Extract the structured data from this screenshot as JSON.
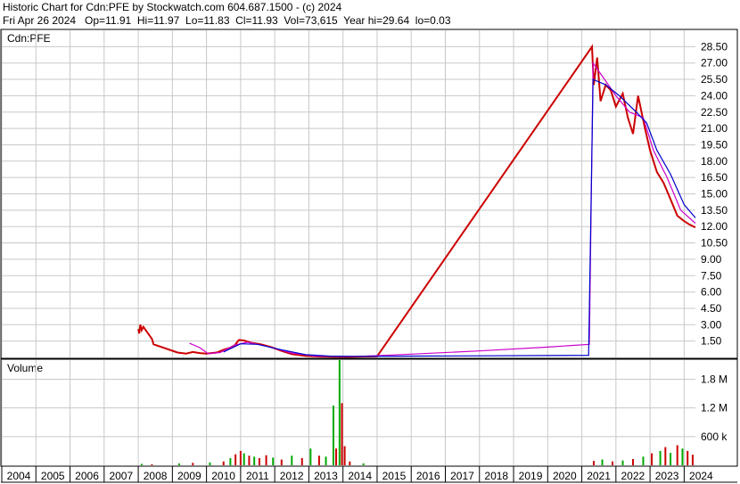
{
  "header": {
    "line1": "Historic Chart for Cdn:PFE by Stockwatch.com 604.687.1500 - (c) 2024",
    "line2": "Fri Apr 26 2024   Op=11.91  Hi=11.97  Lo=11.83  Cl=11.93  Vol=73,615  Year hi=29.64  lo=0.03"
  },
  "chart_data": [
    {
      "type": "line",
      "title": "Cdn:PFE",
      "y_ticks": [
        "28.50",
        "27.00",
        "25.50",
        "24.00",
        "22.50",
        "21.00",
        "19.50",
        "18.00",
        "16.50",
        "15.00",
        "13.50",
        "12.00",
        "10.50",
        "9.00",
        "7.50",
        "6.00",
        "4.50",
        "3.00",
        "1.50"
      ],
      "ylim": [
        0,
        30
      ],
      "x_years": [
        "2004",
        "2005",
        "2006",
        "2007",
        "2008",
        "2009",
        "2010",
        "2011",
        "2012",
        "2013",
        "2014",
        "2015",
        "2016",
        "2017",
        "2018",
        "2019",
        "2020",
        "2021",
        "2022",
        "2023",
        "2024"
      ],
      "xlim": [
        2004,
        2024.33
      ],
      "grid": true,
      "series": [
        {
          "color": "#cc0000",
          "points": [
            [
              2008.0,
              2.6
            ],
            [
              2008.03,
              2.2
            ],
            [
              2008.06,
              3.0
            ],
            [
              2008.1,
              2.5
            ],
            [
              2008.15,
              2.8
            ],
            [
              2008.4,
              1.7
            ],
            [
              2008.45,
              1.2
            ],
            [
              2009.15,
              0.45
            ],
            [
              2009.4,
              0.35
            ],
            [
              2009.6,
              0.5
            ],
            [
              2009.8,
              0.4
            ],
            [
              2010.0,
              0.35
            ],
            [
              2010.3,
              0.45
            ],
            [
              2010.5,
              0.7
            ],
            [
              2010.8,
              1.0
            ],
            [
              2010.95,
              1.6
            ],
            [
              2011.1,
              1.55
            ],
            [
              2011.3,
              1.35
            ],
            [
              2011.6,
              1.2
            ],
            [
              2011.9,
              0.95
            ],
            [
              2012.2,
              0.6
            ],
            [
              2012.5,
              0.3
            ],
            [
              2012.9,
              0.15
            ],
            [
              2013.3,
              0.08
            ],
            [
              2013.7,
              0.06
            ],
            [
              2014.2,
              0.05
            ],
            [
              2014.6,
              0.08
            ],
            [
              2015.0,
              0.1
            ],
            [
              2021.3,
              28.5
            ],
            [
              2021.35,
              25.0
            ],
            [
              2021.45,
              27.5
            ],
            [
              2021.55,
              23.5
            ],
            [
              2021.7,
              25.0
            ],
            [
              2021.85,
              24.5
            ],
            [
              2022.0,
              23.0
            ],
            [
              2022.2,
              24.2
            ],
            [
              2022.35,
              22.0
            ],
            [
              2022.5,
              20.5
            ],
            [
              2022.65,
              24.0
            ],
            [
              2022.85,
              21.0
            ],
            [
              2023.0,
              19.0
            ],
            [
              2023.2,
              17.0
            ],
            [
              2023.4,
              16.0
            ],
            [
              2023.6,
              14.5
            ],
            [
              2023.8,
              13.0
            ],
            [
              2024.0,
              12.5
            ],
            [
              2024.15,
              12.2
            ],
            [
              2024.33,
              11.93
            ]
          ]
        },
        {
          "color": "#cc00cc",
          "points": [
            [
              2009.5,
              1.3
            ],
            [
              2009.8,
              0.9
            ],
            [
              2010.05,
              0.35
            ],
            [
              2010.4,
              0.45
            ],
            [
              2010.8,
              1.1
            ],
            [
              2011.2,
              1.4
            ],
            [
              2011.8,
              1.0
            ],
            [
              2012.5,
              0.4
            ],
            [
              2013.2,
              0.12
            ],
            [
              2014.0,
              0.08
            ],
            [
              2014.5,
              0.1
            ],
            [
              2016.0,
              0.3
            ],
            [
              2018.0,
              0.6
            ],
            [
              2020.0,
              0.95
            ],
            [
              2021.22,
              1.2
            ],
            [
              2021.33,
              27.0
            ],
            [
              2021.6,
              25.8
            ],
            [
              2022.0,
              24.0
            ],
            [
              2022.4,
              22.5
            ],
            [
              2022.8,
              22.0
            ],
            [
              2023.1,
              19.0
            ],
            [
              2023.5,
              16.5
            ],
            [
              2023.9,
              13.5
            ],
            [
              2024.33,
              12.3
            ]
          ]
        },
        {
          "color": "#0000cc",
          "points": [
            [
              2010.5,
              0.5
            ],
            [
              2011.0,
              1.25
            ],
            [
              2011.5,
              1.2
            ],
            [
              2012.2,
              0.7
            ],
            [
              2012.9,
              0.25
            ],
            [
              2013.6,
              0.12
            ],
            [
              2014.3,
              0.1
            ],
            [
              2016.0,
              0.12
            ],
            [
              2018.0,
              0.15
            ],
            [
              2021.2,
              0.2
            ],
            [
              2021.33,
              25.5
            ],
            [
              2021.7,
              25.0
            ],
            [
              2022.1,
              24.0
            ],
            [
              2022.6,
              22.5
            ],
            [
              2022.9,
              21.5
            ],
            [
              2023.2,
              19.0
            ],
            [
              2023.6,
              16.8
            ],
            [
              2024.0,
              14.0
            ],
            [
              2024.33,
              12.8
            ]
          ]
        }
      ]
    },
    {
      "type": "bar",
      "title": "Volume",
      "y_ticks": [
        "1.8 M",
        "1.2 M",
        "600 k"
      ],
      "ylim": [
        0,
        2200000
      ],
      "xlim": [
        2004,
        2024.33
      ],
      "grid": true,
      "bars": [
        {
          "x": 2008.1,
          "v": 30000,
          "c": "#00aa00"
        },
        {
          "x": 2008.4,
          "v": 20000,
          "c": "#cc0000"
        },
        {
          "x": 2009.2,
          "v": 40000,
          "c": "#00aa00"
        },
        {
          "x": 2009.6,
          "v": 50000,
          "c": "#cc0000"
        },
        {
          "x": 2010.1,
          "v": 60000,
          "c": "#00aa00"
        },
        {
          "x": 2010.5,
          "v": 80000,
          "c": "#cc0000"
        },
        {
          "x": 2010.7,
          "v": 150000,
          "c": "#00aa00"
        },
        {
          "x": 2010.85,
          "v": 230000,
          "c": "#cc0000"
        },
        {
          "x": 2011.0,
          "v": 300000,
          "c": "#cc0000"
        },
        {
          "x": 2011.1,
          "v": 250000,
          "c": "#00aa00"
        },
        {
          "x": 2011.25,
          "v": 200000,
          "c": "#cc0000"
        },
        {
          "x": 2011.4,
          "v": 180000,
          "c": "#00aa00"
        },
        {
          "x": 2011.55,
          "v": 150000,
          "c": "#cc0000"
        },
        {
          "x": 2011.75,
          "v": 210000,
          "c": "#cc0000"
        },
        {
          "x": 2011.95,
          "v": 160000,
          "c": "#00aa00"
        },
        {
          "x": 2012.2,
          "v": 120000,
          "c": "#cc0000"
        },
        {
          "x": 2012.5,
          "v": 200000,
          "c": "#00aa00"
        },
        {
          "x": 2012.8,
          "v": 150000,
          "c": "#cc0000"
        },
        {
          "x": 2013.05,
          "v": 350000,
          "c": "#00aa00"
        },
        {
          "x": 2013.3,
          "v": 200000,
          "c": "#cc0000"
        },
        {
          "x": 2013.5,
          "v": 180000,
          "c": "#00aa00"
        },
        {
          "x": 2013.72,
          "v": 1250000,
          "c": "#00aa00"
        },
        {
          "x": 2013.8,
          "v": 350000,
          "c": "#cc0000"
        },
        {
          "x": 2013.9,
          "v": 2200000,
          "c": "#00aa00"
        },
        {
          "x": 2013.97,
          "v": 1300000,
          "c": "#cc0000"
        },
        {
          "x": 2014.05,
          "v": 400000,
          "c": "#cc0000"
        },
        {
          "x": 2014.2,
          "v": 80000,
          "c": "#cc0000"
        },
        {
          "x": 2014.6,
          "v": 40000,
          "c": "#00aa00"
        },
        {
          "x": 2021.35,
          "v": 90000,
          "c": "#cc0000"
        },
        {
          "x": 2021.6,
          "v": 120000,
          "c": "#00aa00"
        },
        {
          "x": 2021.9,
          "v": 80000,
          "c": "#cc0000"
        },
        {
          "x": 2022.2,
          "v": 100000,
          "c": "#00aa00"
        },
        {
          "x": 2022.5,
          "v": 130000,
          "c": "#cc0000"
        },
        {
          "x": 2022.8,
          "v": 180000,
          "c": "#00aa00"
        },
        {
          "x": 2023.05,
          "v": 250000,
          "c": "#cc0000"
        },
        {
          "x": 2023.3,
          "v": 300000,
          "c": "#00aa00"
        },
        {
          "x": 2023.45,
          "v": 380000,
          "c": "#cc0000"
        },
        {
          "x": 2023.6,
          "v": 260000,
          "c": "#00aa00"
        },
        {
          "x": 2023.8,
          "v": 420000,
          "c": "#cc0000"
        },
        {
          "x": 2023.95,
          "v": 350000,
          "c": "#00aa00"
        },
        {
          "x": 2024.1,
          "v": 300000,
          "c": "#cc0000"
        },
        {
          "x": 2024.25,
          "v": 220000,
          "c": "#cc0000"
        }
      ]
    }
  ]
}
